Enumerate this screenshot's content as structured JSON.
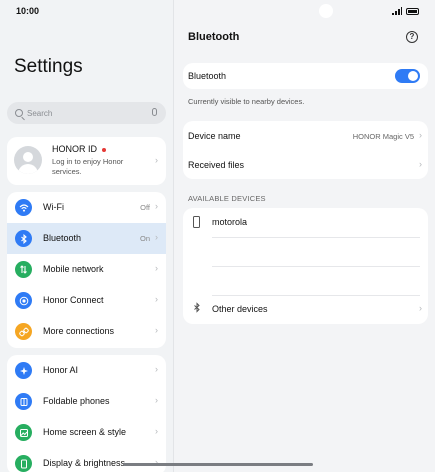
{
  "status_bar": {
    "time": "10:00"
  },
  "left_pane": {
    "title": "Settings",
    "search": {
      "placeholder": "Search"
    },
    "account": {
      "title": "HONOR ID",
      "subtitle": "Log in to enjoy Honor services."
    },
    "group1": [
      {
        "label": "Wi-Fi",
        "value": "Off",
        "icon": "wifi-icon",
        "color": "#2f7bf5"
      },
      {
        "label": "Bluetooth",
        "value": "On",
        "icon": "bluetooth-icon",
        "color": "#2f7bf5",
        "active": true
      },
      {
        "label": "Mobile network",
        "value": "",
        "icon": "mobile-network-icon",
        "color": "#27ae60"
      },
      {
        "label": "Honor Connect",
        "value": "",
        "icon": "honor-connect-icon",
        "color": "#2f7bf5"
      },
      {
        "label": "More connections",
        "value": "",
        "icon": "more-connections-icon",
        "color": "#f5a623"
      }
    ],
    "group2": [
      {
        "label": "Honor AI",
        "icon": "honor-ai-icon",
        "color": "#2f7bf5"
      },
      {
        "label": "Foldable phones",
        "icon": "foldable-phones-icon",
        "color": "#2f7bf5"
      },
      {
        "label": "Home screen & style",
        "icon": "home-screen-icon",
        "color": "#27ae60"
      },
      {
        "label": "Display & brightness",
        "icon": "display-brightness-icon",
        "color": "#27ae60"
      }
    ]
  },
  "right_pane": {
    "title": "Bluetooth",
    "bluetooth_toggle": {
      "label": "Bluetooth",
      "state": "on",
      "color": "#2f7bf5"
    },
    "visible_note": "Currently visible to nearby devices.",
    "device_name": {
      "label": "Device name",
      "value": "HONOR Magic V5"
    },
    "received_files": {
      "label": "Received files"
    },
    "available_header": "AVAILABLE DEVICES",
    "devices": [
      {
        "name": "motorola"
      }
    ],
    "other_devices": "Other devices"
  }
}
